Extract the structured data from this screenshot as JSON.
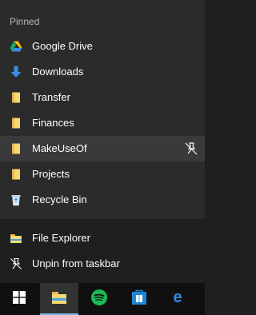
{
  "jumplist": {
    "section_title": "Pinned",
    "pinned": [
      {
        "label": "Google Drive",
        "icon": "google-drive-icon"
      },
      {
        "label": "Downloads",
        "icon": "downloads-icon"
      },
      {
        "label": "Transfer",
        "icon": "folder-icon"
      },
      {
        "label": "Finances",
        "icon": "folder-icon"
      },
      {
        "label": "MakeUseOf",
        "icon": "folder-icon",
        "hovered": true
      },
      {
        "label": "Projects",
        "icon": "folder-icon"
      },
      {
        "label": "Recycle Bin",
        "icon": "recycle-bin-icon"
      }
    ],
    "tasks": [
      {
        "label": "File Explorer",
        "icon": "file-explorer-icon"
      },
      {
        "label": "Unpin from taskbar",
        "icon": "unpin-icon"
      }
    ]
  },
  "taskbar": {
    "buttons": [
      {
        "name": "start-button",
        "icon": "windows-logo-icon"
      },
      {
        "name": "file-explorer-taskbar-button",
        "icon": "file-explorer-icon",
        "active": true
      },
      {
        "name": "spotify-taskbar-button",
        "icon": "spotify-icon"
      },
      {
        "name": "store-taskbar-button",
        "icon": "store-icon"
      },
      {
        "name": "edge-taskbar-button",
        "icon": "edge-icon"
      }
    ]
  },
  "colors": {
    "jumplist_bg": "#2b2b2b",
    "hover_bg": "#3a3a3a",
    "tasks_bg": "#1f1f1f",
    "taskbar_bg": "#101010",
    "active_indicator": "#76b9ed",
    "folder_yellow": "#f8d775"
  }
}
